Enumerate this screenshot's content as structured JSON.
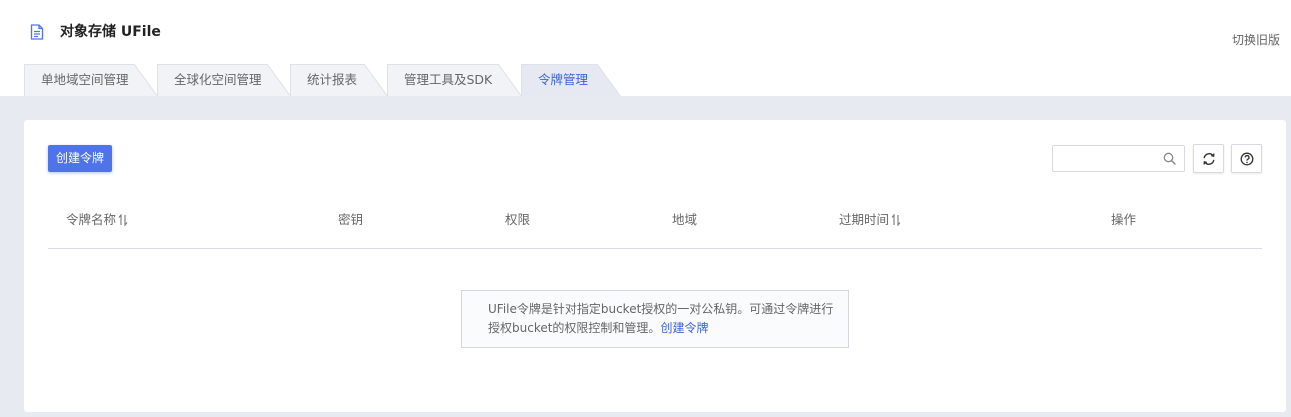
{
  "header": {
    "title": "对象存储 UFile",
    "switch_label": "切换旧版"
  },
  "tabs": [
    {
      "label": "单地域空间管理",
      "active": false
    },
    {
      "label": "全球化空间管理",
      "active": false
    },
    {
      "label": "统计报表",
      "active": false
    },
    {
      "label": "管理工具及SDK",
      "active": false
    },
    {
      "label": "令牌管理",
      "active": true
    }
  ],
  "toolbar": {
    "create_label": "创建令牌",
    "search_value": "",
    "search_placeholder": ""
  },
  "table": {
    "columns": [
      "令牌名称",
      "密钥",
      "权限",
      "地域",
      "过期时间",
      "操作"
    ]
  },
  "empty": {
    "line1": "UFile令牌是针对指定bucket授权的一对公私钥。可通过令牌进行",
    "line2_prefix": "授权bucket的权限控制和管理。",
    "link": "创建令牌"
  },
  "colors": {
    "accent": "#4f74ea",
    "link": "#3d63d9",
    "page_bg": "#e8eaf2",
    "tab_bg": "#f2f3f7",
    "tab_active_bg": "#e6e9f2"
  },
  "icons": {
    "title": "document-icon",
    "search": "search-icon",
    "refresh": "refresh-icon",
    "help": "help-icon",
    "sort": "sort-icon"
  }
}
